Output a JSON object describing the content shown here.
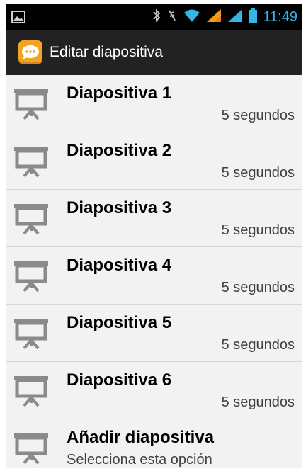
{
  "status_bar": {
    "time": "11:49",
    "icons": [
      "image-notification-icon",
      "bluetooth-icon",
      "vibrate-icon",
      "wifi-icon",
      "signal-icon",
      "signal-icon",
      "battery-icon"
    ],
    "accent_color": "#33b5e5"
  },
  "action_bar": {
    "title": "Editar diapositiva",
    "app_icon": "speech-bubble-icon",
    "icon_color": "#f3a31f"
  },
  "slides": [
    {
      "title": "Diapositiva 1",
      "duration": "5 segundos"
    },
    {
      "title": "Diapositiva 2",
      "duration": "5 segundos"
    },
    {
      "title": "Diapositiva 3",
      "duration": "5 segundos"
    },
    {
      "title": "Diapositiva 4",
      "duration": "5 segundos"
    },
    {
      "title": "Diapositiva 5",
      "duration": "5 segundos"
    },
    {
      "title": "Diapositiva 6",
      "duration": "5 segundos"
    }
  ],
  "add_item": {
    "title": "Añadir diapositiva",
    "subtitle": "Selecciona esta opción"
  }
}
